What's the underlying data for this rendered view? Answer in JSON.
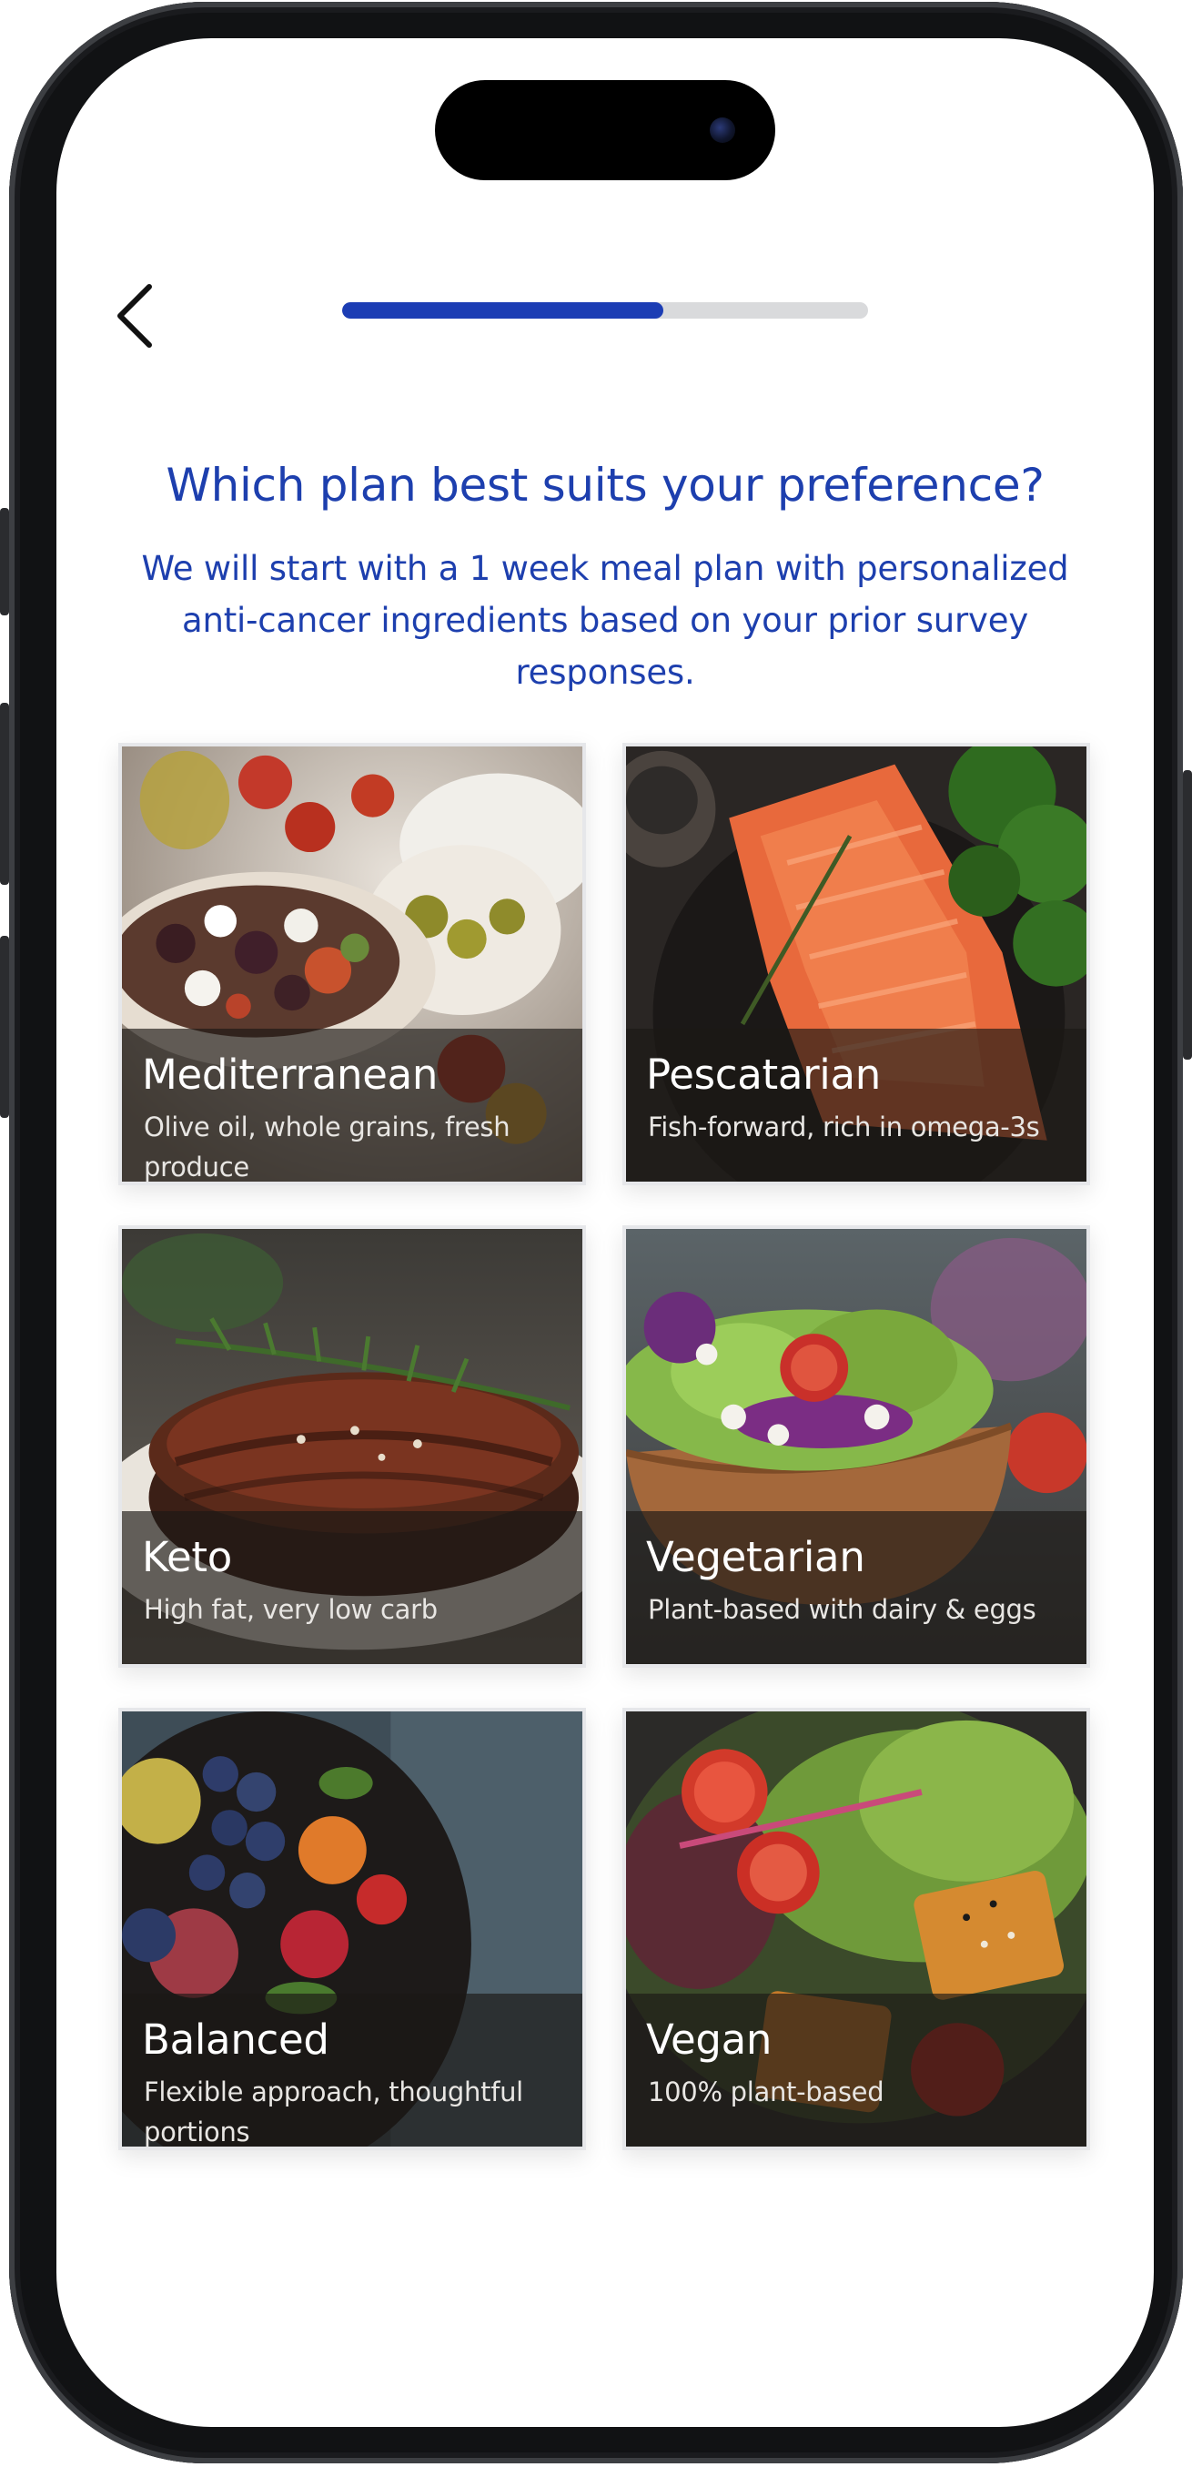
{
  "header": {
    "back_icon": "chevron-left-icon",
    "progress_fraction": 0.61
  },
  "title": "Which plan best suits your preference?",
  "subtitle": "We will start with a 1 week meal plan with personalized anti-cancer ingredients based on your prior survey responses.",
  "colors": {
    "accent": "#1d3fae",
    "progress_fill": "#1c3db4",
    "progress_track": "#d9dadc"
  },
  "plans": [
    {
      "name": "Mediterranean",
      "description": "Olive oil, whole grains, fresh produce",
      "image": "mediterranean-salad-image"
    },
    {
      "name": "Pescatarian",
      "description": "Fish-forward, rich in omega-3s",
      "image": "salmon-fillet-image"
    },
    {
      "name": "Keto",
      "description": "High fat, very low carb",
      "image": "steak-image"
    },
    {
      "name": "Vegetarian",
      "description": "Plant-based with dairy & eggs",
      "image": "salad-bowl-image"
    },
    {
      "name": "Balanced",
      "description": "Flexible approach, thoughtful portions",
      "image": "fruit-bowl-image"
    },
    {
      "name": "Vegan",
      "description": "100% plant-based",
      "image": "tofu-greens-image"
    }
  ]
}
